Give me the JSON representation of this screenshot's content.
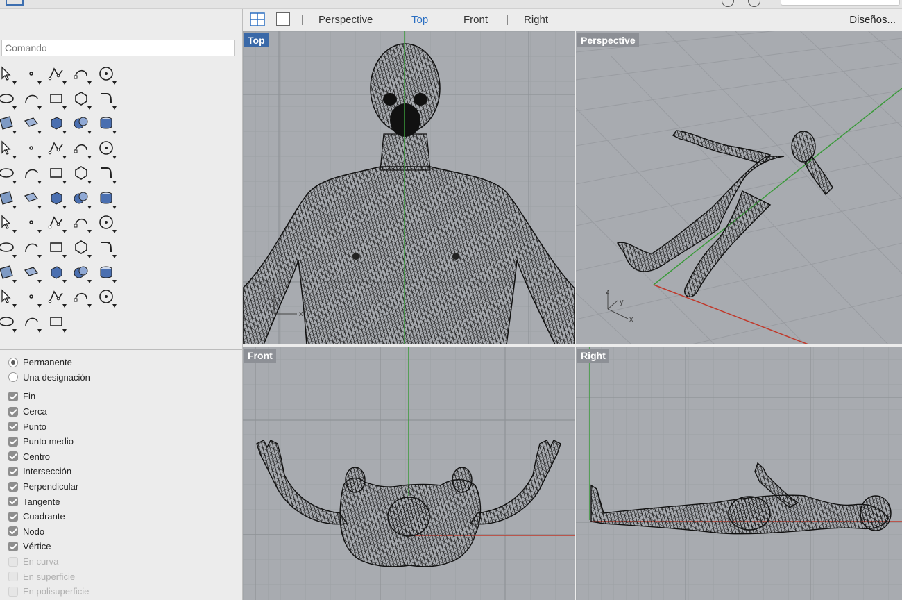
{
  "command": {
    "placeholder": "Comando"
  },
  "tabs": {
    "perspective": "Perspective",
    "top": "Top",
    "front": "Front",
    "right": "Right",
    "active": "Top",
    "layouts_button": "Diseños..."
  },
  "viewports": {
    "top_label": "Top",
    "perspective_label": "Perspective",
    "front_label": "Front",
    "right_label": "Right",
    "axis": {
      "x": "x",
      "y": "y",
      "z": "z"
    }
  },
  "osnap": {
    "modes": [
      {
        "label": "Permanente",
        "selected": true
      },
      {
        "label": "Una designación",
        "selected": false
      }
    ],
    "options": [
      {
        "label": "Fin",
        "checked": true
      },
      {
        "label": "Cerca",
        "checked": true
      },
      {
        "label": "Punto",
        "checked": true
      },
      {
        "label": "Punto medio",
        "checked": true
      },
      {
        "label": "Centro",
        "checked": true
      },
      {
        "label": "Intersección",
        "checked": true
      },
      {
        "label": "Perpendicular",
        "checked": true
      },
      {
        "label": "Tangente",
        "checked": true
      },
      {
        "label": "Cuadrante",
        "checked": true
      },
      {
        "label": "Nodo",
        "checked": true
      },
      {
        "label": "Vértice",
        "checked": true
      },
      {
        "label": "En curva",
        "checked": false
      },
      {
        "label": "En superficie",
        "checked": false
      },
      {
        "label": "En polisuperficie",
        "checked": false
      }
    ]
  },
  "tool_icons": [
    "select-arrow-icon",
    "point-icon",
    "polyline-icon",
    "curve-icon",
    "circle-icon",
    "ellipse-icon",
    "arc-icon",
    "rectangle-icon",
    "polygon-icon",
    "fillet-icon",
    "surface-icon",
    "extrude-surface-icon",
    "box-icon",
    "sphere-icon",
    "cylinder-icon",
    "plane-icon",
    "puzzle-icon",
    "explode-icon",
    "trim-icon",
    "split-icon",
    "boolean-icon",
    "group-icon",
    "curve-edit-icon",
    "offset-icon",
    "text-icon",
    "move-icon",
    "align-icon",
    "scale-icon",
    "solid-edit-icon",
    "dimension-icon",
    "array-icon",
    "distribute-icon",
    "transform-icon",
    "check-icon",
    "analyze-icon",
    "snap-icon",
    "zoom-icon",
    "zoom-window-icon",
    "zoom-extents-icon",
    "zoom-selected-icon",
    "rotate-view-icon",
    "car-icon",
    "grid-icon",
    "lights-icon",
    "bulb-icon",
    "lock-icon",
    "material-icon",
    "color-wheel-icon",
    "render-sphere-icon",
    "wireframe-sphere-icon",
    "blue-sphere-icon",
    "cone-icon",
    "history-icon"
  ],
  "colors": {
    "accent": "#2b6fc2",
    "viewport_bg": "#a8abb0",
    "axis_green": "#3a9a3a",
    "axis_red": "#c0392b"
  }
}
